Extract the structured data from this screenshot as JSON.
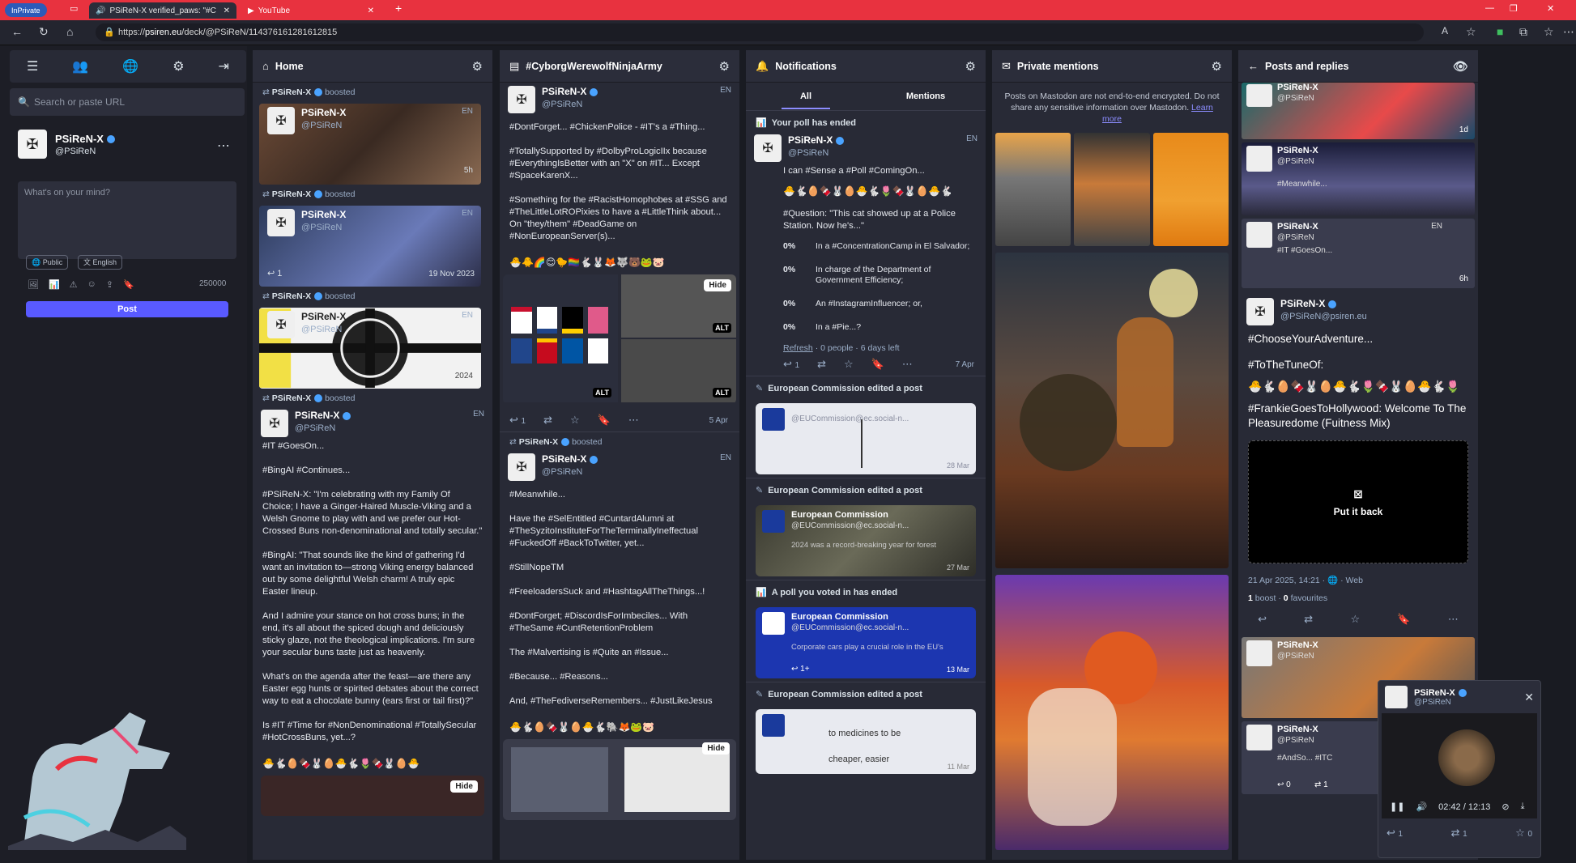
{
  "browser": {
    "inprivate_label": "InPrivate",
    "tabs": [
      {
        "label": "PSiReN-X verified_paws: \"#C",
        "active": true
      },
      {
        "label": "YouTube",
        "active": false
      }
    ],
    "url_domain": "psiren.eu",
    "url_prefix": "https://",
    "url_path": "/deck/@PSiReN/114376161281612815",
    "new_tab": "+"
  },
  "sidebar": {
    "search_placeholder": "Search or paste URL",
    "profile": {
      "name": "PSiReN-X",
      "handle": "@PSiReN"
    },
    "compose_placeholder": "What's on your mind?",
    "visibility": "Public",
    "language": "English",
    "char_count": "250000",
    "post_label": "Post"
  },
  "columns": {
    "home": {
      "title": "Home",
      "cards": [
        {
          "boost_by": "PSiReN-X",
          "boost_label": "boosted",
          "name": "PSiReN-X",
          "handle": "@PSiReN",
          "lang": "EN",
          "ts": "5h"
        },
        {
          "boost_by": "PSiReN-X",
          "boost_label": "boosted",
          "name": "PSiReN-X",
          "handle": "@PSiReN",
          "lang": "EN",
          "ts": "19 Nov 2023",
          "reply_count": "1"
        },
        {
          "boost_by": "PSiReN-X",
          "boost_label": "boosted",
          "name": "PSiReN-X",
          "handle": "@PSiReN",
          "lang": "EN",
          "ts": "2024"
        },
        {
          "boost_by": "PSiReN-X",
          "boost_label": "boosted",
          "name": "PSiReN-X",
          "handle": "@PSiReN",
          "lang": "EN"
        }
      ],
      "body": [
        "#IT #GoesOn...",
        "#BingAI #Continues...",
        "#PSiReN-X: \"I'm celebrating with my Family Of Choice; I have a Ginger-Haired Muscle-Viking and a Welsh Gnome to play with and we prefer our Hot-Crossed Buns non-denominational and totally secular.\"",
        "#BingAI: \"That sounds like the kind of gathering I'd want an invitation to—strong Viking energy balanced out by some delightful Welsh charm! A truly epic Easter lineup.",
        "And I admire your stance on hot cross buns; in the end, it's all about the spiced dough and deliciously sticky glaze, not the theological implications. I'm sure your secular buns taste just as heavenly.",
        "What's on the agenda after the feast—are there any Easter egg hunts or spirited debates about the correct way to eat a chocolate bunny (ears first or tail first)?\"",
        "Is #IT #Time for #NonDenominational #TotallySecular #HotCrossBuns, yet...?"
      ],
      "emoji_line": "🐣🐇🥚🍫🐰🥚🐣🐇🌷🍫🐰🥚🐣",
      "hide_label": "Hide"
    },
    "cyborg": {
      "title": "#CyborgWerewolfNinjaArmy",
      "post1": {
        "name": "PSiReN-X",
        "handle": "@PSiReN",
        "lang": "EN",
        "body": [
          "#DontForget... #ChickenPolice - #IT's a #Thing...",
          "#TotallySupported by #DolbyProLogicIIx because #EverythingIsBetter with an \"X\" on #IT... Except #SpaceKarenX...",
          "#Something for the #RacistHomophobes at #SSG and #TheLittleLotROPixies to have a #LittleThink about... On \"they/them\" #DeadGame on #NonEuropeanServer(s)..."
        ],
        "emoji_line": "🐣🐥🌈😊🐤🏳️‍🌈🐇🐰🦊🐺🐻🐸🐷",
        "hide_label": "Hide",
        "alt_label": "ALT",
        "reply_count": "1",
        "ts": "5 Apr"
      },
      "post2": {
        "boost_by": "PSiReN-X",
        "boost_label": "boosted",
        "name": "PSiReN-X",
        "handle": "@PSiReN",
        "lang": "EN",
        "body": [
          "#Meanwhile...",
          "Have the #SelEntitled #CuntardAlumni at #TheSyzitoInstituteForTheTerminallyIneffectual #FuckedOff #BackToTwitter, yet...",
          "#StillNopeTM",
          "#FreeloadersSuck and #HashtagAllTheThings...!",
          "#DontForget; #DiscordIsForImbeciles... With #TheSame #CuntRetentionProblem",
          "The #Malvertising is #Quite an #Issue...",
          "#Because... #Reasons...",
          "And, #TheFediverseRemembers... #JustLikeJesus"
        ],
        "emoji_line": "🐣🐇🥚🍫🐰🥚🐣🐇🐘🦊🐸🐷",
        "hide_label": "Hide"
      }
    },
    "notifications": {
      "title": "Notifications",
      "tab_all": "All",
      "tab_mentions": "Mentions",
      "poll_ended": "Your poll has ended",
      "poll_post": {
        "name": "PSiReN-X",
        "handle": "@PSiReN",
        "lang": "EN",
        "line1": "I can #Sense a #Poll #ComingOn...",
        "emoji_line": "🐣🐇🥚🍫🐰🥚🐣🐇🌷🍫🐰🥚🐣🐇",
        "question": "#Question: \"This cat showed up at a Police Station. Now he's...\"",
        "options": [
          {
            "pct": "0%",
            "text": "In a #ConcentrationCamp in El Salvador;"
          },
          {
            "pct": "0%",
            "text": "In charge of the Department of Government Efficiency;"
          },
          {
            "pct": "0%",
            "text": "An #InstagramInfluencer; or,"
          },
          {
            "pct": "0%",
            "text": "In a #Pie...?"
          }
        ],
        "refresh": "Refresh",
        "poll_stats": "· 0 people · 6 days left",
        "reply_count": "1",
        "ts": "7 Apr"
      },
      "edit1": {
        "label": "European Commission edited a post",
        "handle": "@EUCommission@ec.social-n...",
        "ts": "28 Mar"
      },
      "edit2": {
        "label": "European Commission edited a post",
        "name": "European Commission",
        "handle": "@EUCommission@ec.social-n...",
        "snippet": "2024 was a record-breaking year for forest",
        "ts": "27 Mar"
      },
      "poll_voted": {
        "label": "A poll you voted in has ended",
        "name": "European Commission",
        "handle": "@EUCommission@ec.social-n...",
        "snippet": "Corporate cars play a crucial role in the EU's",
        "reply_count": "1+",
        "ts": "13 Mar"
      },
      "edit3": {
        "label": "European Commission edited a post",
        "line_a": "to medicines to be",
        "line_b": "cheaper, easier",
        "ts": "11 Mar"
      }
    },
    "private": {
      "title": "Private mentions",
      "notice": "Posts on Mastodon are not end-to-end encrypted. Do not share any sensitive information over Mastodon.",
      "learn_more": "Learn more"
    },
    "posts": {
      "title": "Posts and replies",
      "top_card1": {
        "name": "PSiReN-X",
        "handle": "@PSiReN",
        "ts": "1d"
      },
      "top_card2": {
        "name": "PSiReN-X",
        "handle": "@PSiReN",
        "snippet": "#Meanwhile..."
      },
      "top_card3": {
        "name": "PSiReN-X",
        "handle": "@PSiReN",
        "snippet": "#IT #GoesOn...",
        "lang": "EN",
        "ts": "6h"
      },
      "main": {
        "name": "PSiReN-X",
        "handle": "@PSiReN@psiren.eu",
        "line1": "#ChooseYourAdventure...",
        "line2": "#ToTheTuneOf:",
        "emoji_line": "🐣🐇🥚🍫🐰🥚🐣🐇🌷🍫🐰🥚🐣🐇🌷",
        "line3": "#FrankieGoesToHollywood: Welcome To The Pleasuredome (Fuitness Mix)",
        "put_back": "Put it back",
        "date": "21 Apr 2025, 14:21",
        "via": "Web",
        "boosts": "1",
        "boost_word": "boost",
        "favs": "0",
        "fav_word": "favourites"
      },
      "bottom_card1": {
        "name": "PSiReN-X",
        "handle": "@PSiReN"
      },
      "bottom_card2": {
        "name": "PSiReN-X",
        "handle": "@PSiReN",
        "snippet": "#AndSo... #ITC",
        "reply_count": "0",
        "boost_count": "1"
      }
    }
  },
  "player": {
    "name": "PSiReN-X",
    "handle": "@PSiReN",
    "time": "02:42 / 12:13",
    "reply_count": "1",
    "boost_count": "1",
    "fav_count": "0"
  }
}
